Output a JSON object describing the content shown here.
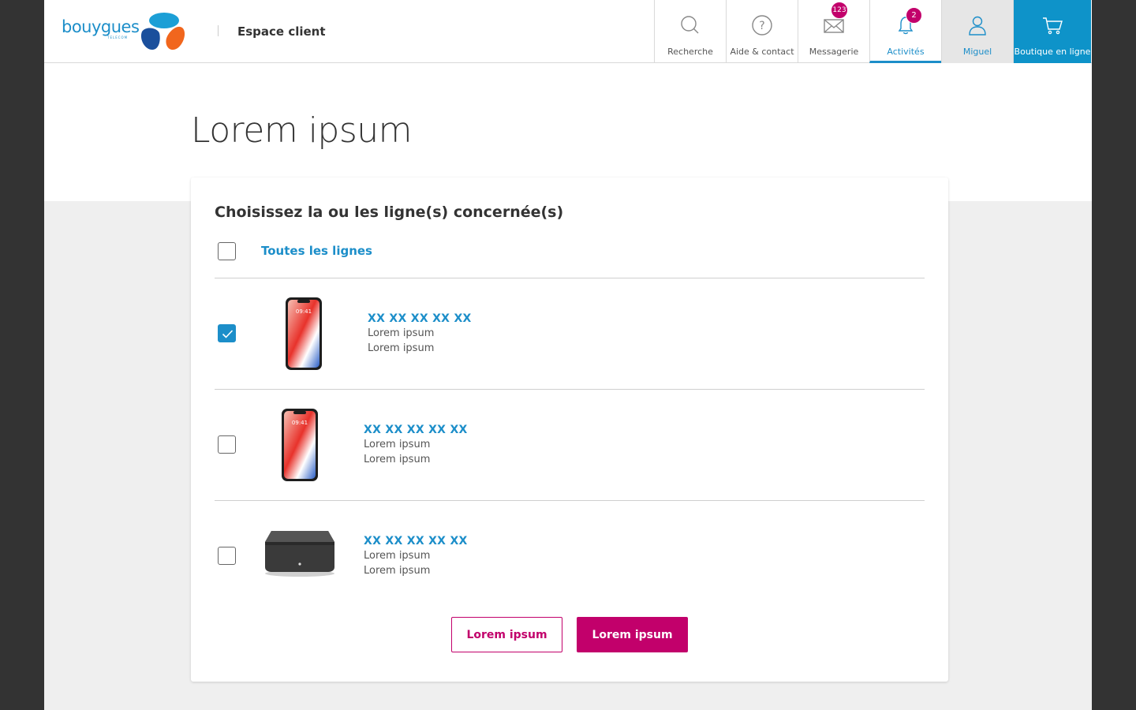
{
  "brand": {
    "logo_text": "bouygues",
    "logo_sub": "TELECOM",
    "section": "Espace client"
  },
  "nav": {
    "search": "Recherche",
    "help": "Aide & contact",
    "messages": "Messagerie",
    "messages_count": "123",
    "activities": "Activités",
    "activities_count": "2",
    "user": "Miguel",
    "shop": "Boutique en ligne"
  },
  "page": {
    "title": "Lorem ipsum"
  },
  "selection": {
    "heading": "Choisissez la ou les ligne(s) concernée(s)",
    "all_lines_label": "Toutes les lignes",
    "all_lines_checked": false,
    "lines": [
      {
        "number": "XX XX XX XX XX",
        "sub1": "Lorem ipsum",
        "sub2": "Lorem ipsum",
        "device": "smartphone",
        "checked": true
      },
      {
        "number": "XX XX XX XX XX",
        "sub1": "Lorem ipsum",
        "sub2": "Lorem ipsum",
        "device": "smartphone",
        "checked": false
      },
      {
        "number": "XX XX XX XX XX",
        "sub1": "Lorem ipsum",
        "sub2": "Lorem ipsum",
        "device": "box",
        "checked": false
      }
    ]
  },
  "actions": {
    "secondary": "Lorem ipsum",
    "primary": "Lorem ipsum"
  },
  "colors": {
    "accent": "#1c8ec9",
    "primary": "#c2006b",
    "background": "#efefef"
  }
}
